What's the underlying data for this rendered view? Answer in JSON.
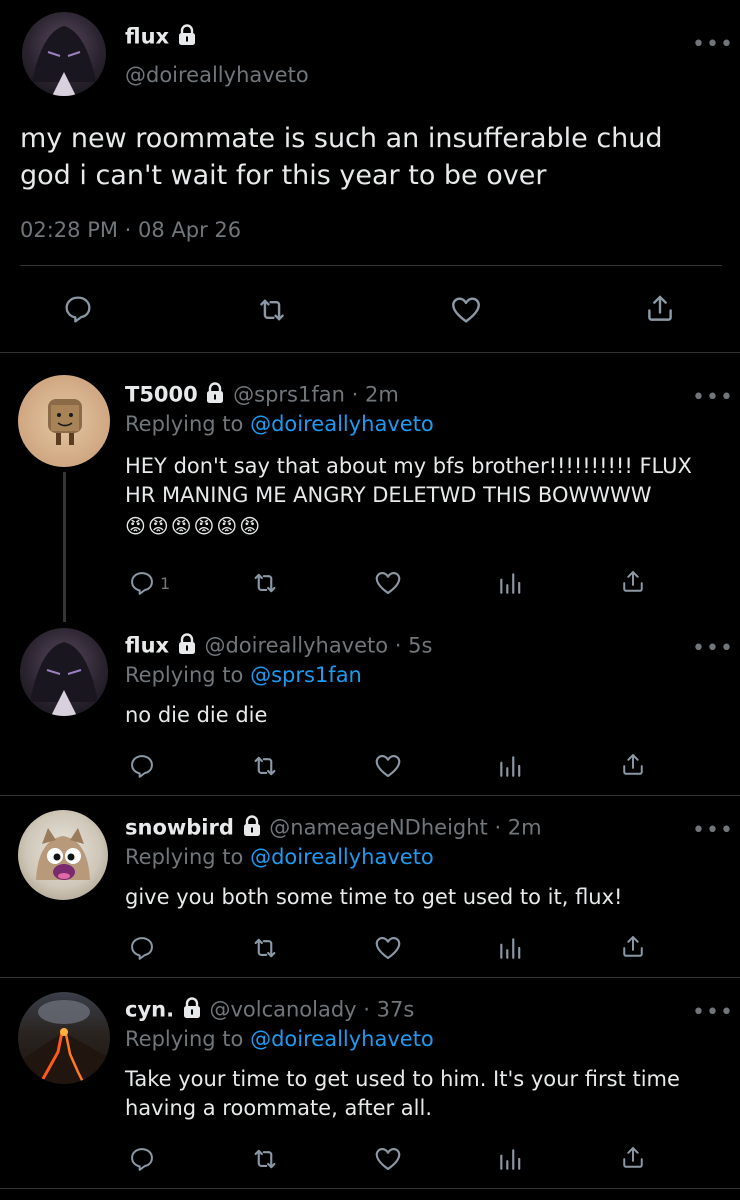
{
  "main_tweet": {
    "display_name": "flux",
    "handle": "@doireallyhaveto",
    "text_line1": "my new roommate is such an insufferable chud",
    "text_line2": "god i can't wait for this year to be over",
    "timestamp": "02:28 PM · 08 Apr 26"
  },
  "replies": [
    {
      "display_name": "T5000",
      "handle": "@sprs1fan · 2m",
      "replying_prefix": "Replying to",
      "replying_to": "@doireallyhaveto",
      "text_line1": "HEY don't say that about my bfs brother!!!!!!!!!! FLUX",
      "text_line2": "HR MANING ME ANGRY DELETWD THIS BOWWWW",
      "emoji": "😡😡😡😡😡😡",
      "reply_count": "1"
    },
    {
      "display_name": "flux",
      "handle": "@doireallyhaveto · 5s",
      "replying_prefix": "Replying to",
      "replying_to": "@sprs1fan",
      "text_line1": "no die die die"
    },
    {
      "display_name": "snowbird",
      "handle": "@nameageNDheight · 2m",
      "replying_prefix": "Replying to",
      "replying_to": "@doireallyhaveto",
      "text_line1": "give you both some time to get used to it, flux!"
    },
    {
      "display_name": "cyn.",
      "handle": "@volcanolady · 37s",
      "replying_prefix": "Replying to",
      "replying_to": "@doireallyhaveto",
      "text_line1": "Take your time to get used to him. It's your first time",
      "text_line2": "having a roommate, after all."
    }
  ],
  "icons": [
    "reply-icon",
    "retweet-icon",
    "like-icon",
    "share-icon",
    "analytics-icon",
    "lock-icon",
    "more-icon"
  ],
  "colors": {
    "background": "#000000",
    "text": "#e7e9ea",
    "muted": "#71767b",
    "link": "#1d9bf0",
    "divider": "#2f3336"
  }
}
